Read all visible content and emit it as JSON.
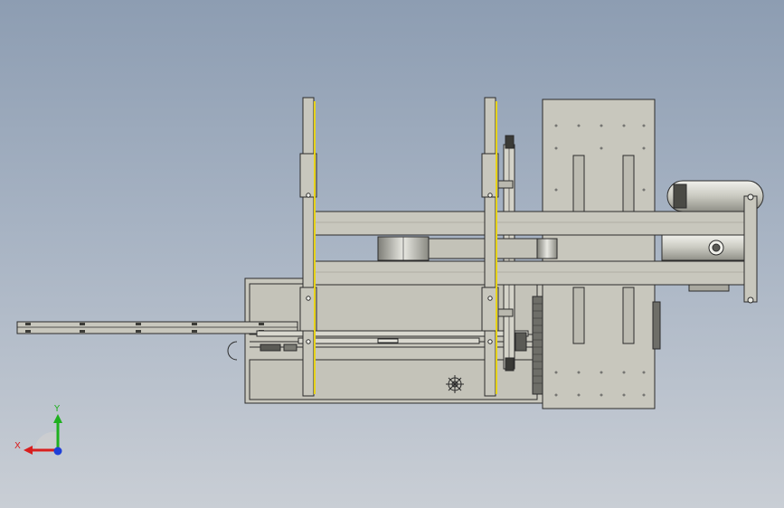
{
  "viewport": {
    "background_top": "#8d9db2",
    "background_bottom": "#c9ced5"
  },
  "model": {
    "part_fill": "#c8c7bd",
    "part_stroke": "#2b2b2b",
    "accent_yellow": "#e6d21a"
  },
  "triad": {
    "x_label": "X",
    "y_label": "Y",
    "x_color": "#d81e1e",
    "y_color": "#1fb01f",
    "z_color": "#1e3fd8"
  }
}
